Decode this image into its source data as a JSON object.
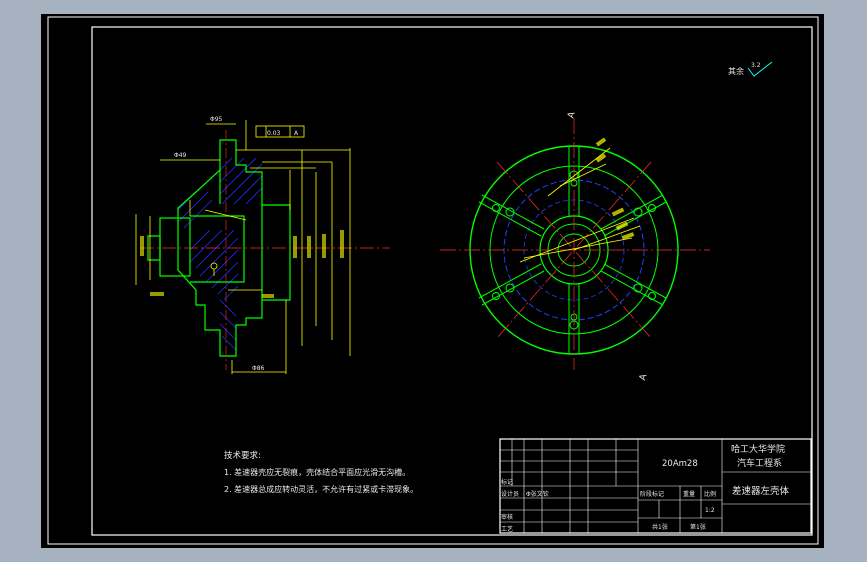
{
  "colors": {
    "viewport_bg": "#a7b2c0",
    "canvas": "#000000",
    "frame": "#ffffff",
    "outline": "#00ff00",
    "dimension": "#ffff00",
    "hatch": "#0000ff",
    "centerline": "#ff0000",
    "title_text": "#00ffff"
  },
  "surface_finish": {
    "label": "其余",
    "value": "3.2"
  },
  "section_view": {
    "tolerance_frame": [
      "0.03",
      "A"
    ],
    "dim_top": "Φ95",
    "dim_left": "Φ49",
    "dim_width": "Φ86"
  },
  "section_markers": {
    "top": "A",
    "bottom": "A"
  },
  "tech_requirements": {
    "heading": "技术要求:",
    "items": [
      "1. 差速器壳应无裂痕，壳体结合平面应光滑无沟槽。",
      "2. 差速器总成应转动灵活，不允许有过紧或卡滞现象。"
    ]
  },
  "title_block": {
    "drawing_no": "20Am28",
    "school": "哈工大华学院",
    "department": "汽车工程系",
    "part_name": "差速器左壳体",
    "designer": "Φ张文钦",
    "rows": {
      "mark": "标记",
      "designer_label": "设计员",
      "reviewer_label": "审核",
      "craft_label": "工艺"
    },
    "stage_mark": "阶段标记",
    "weight": "重量",
    "scale_label": "比例",
    "scale_value": "1:2",
    "sheet_count": "共1张",
    "sheet_no": "第1张"
  }
}
